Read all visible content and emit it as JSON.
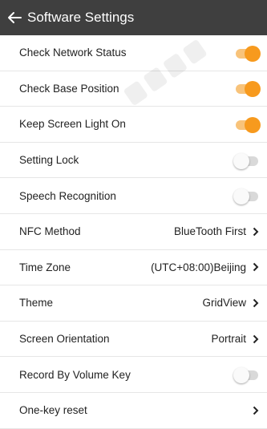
{
  "header": {
    "title": "Software Settings",
    "back_icon": "arrow-left-icon"
  },
  "colors": {
    "header_bg": "#3f3f3f",
    "accent": "#f79a1e",
    "divider": "#e6e6e6"
  },
  "settings": {
    "check_network_status": {
      "label": "Check Network Status",
      "enabled": true
    },
    "check_base_position": {
      "label": "Check Base Position",
      "enabled": true
    },
    "keep_screen_light_on": {
      "label": "Keep Screen Light On",
      "enabled": true
    },
    "setting_lock": {
      "label": "Setting Lock",
      "enabled": false
    },
    "speech_recognition": {
      "label": "Speech Recognition",
      "enabled": false
    },
    "nfc_method": {
      "label": "NFC Method",
      "value": "BlueTooth First"
    },
    "time_zone": {
      "label": "Time Zone",
      "value": "(UTC+08:00)Beijing"
    },
    "theme": {
      "label": "Theme",
      "value": "GridView"
    },
    "screen_orientation": {
      "label": "Screen Orientation",
      "value": "Portrait"
    },
    "record_by_volume_key": {
      "label": "Record By Volume Key",
      "enabled": false
    },
    "one_key_reset": {
      "label": "One-key reset"
    }
  }
}
